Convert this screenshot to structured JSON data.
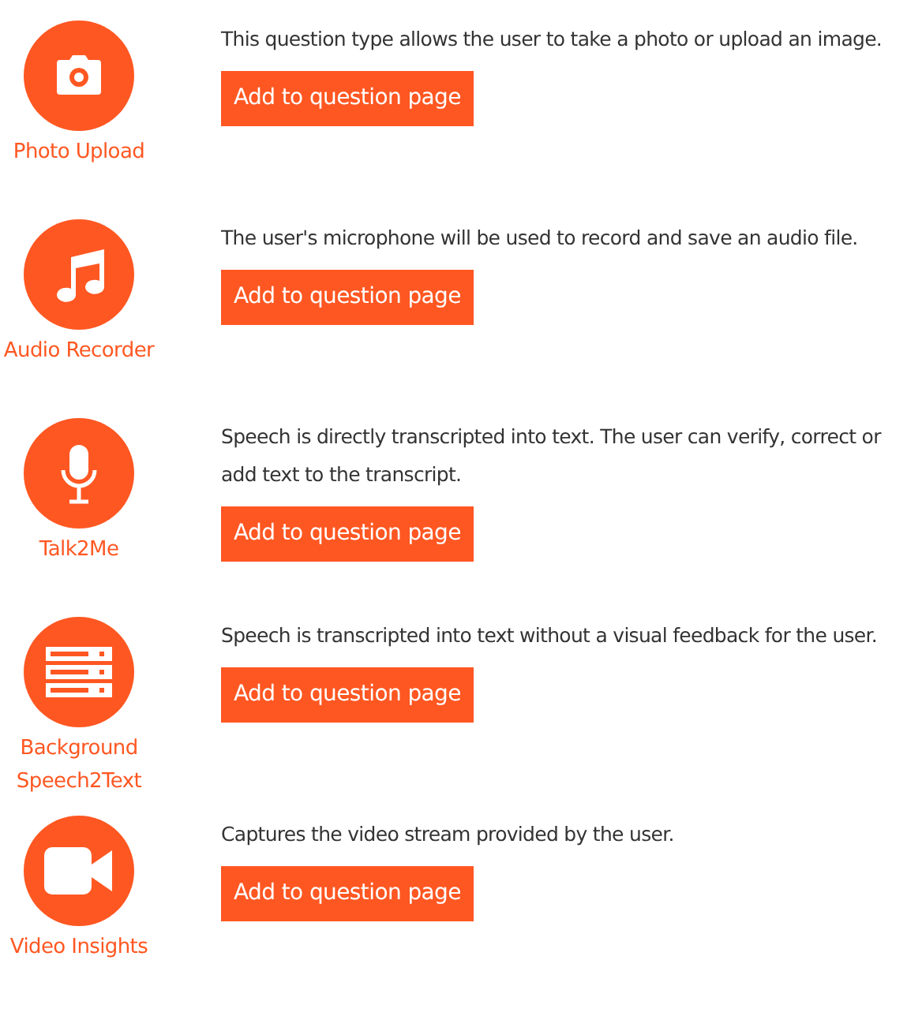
{
  "question_types": [
    {
      "label": "Photo Upload",
      "description": "This question type allows the user to take a photo or upload an image.",
      "button": "Add to question page"
    },
    {
      "label": "Audio Recorder",
      "description": "The user's microphone will be used to record and save an audio file.",
      "button": "Add to question page"
    },
    {
      "label": "Talk2Me",
      "description": "Speech is directly transcripted into text. The user can verify, correct or add text to the transcript.",
      "button": "Add to question page"
    },
    {
      "label": "Background Speech2Text",
      "description": "Speech is transcripted into text without a visual feedback for the user.",
      "button": "Add to question page"
    },
    {
      "label": "Video Insights",
      "description": "Captures the video stream provided by the user.",
      "button": "Add to question page"
    }
  ]
}
